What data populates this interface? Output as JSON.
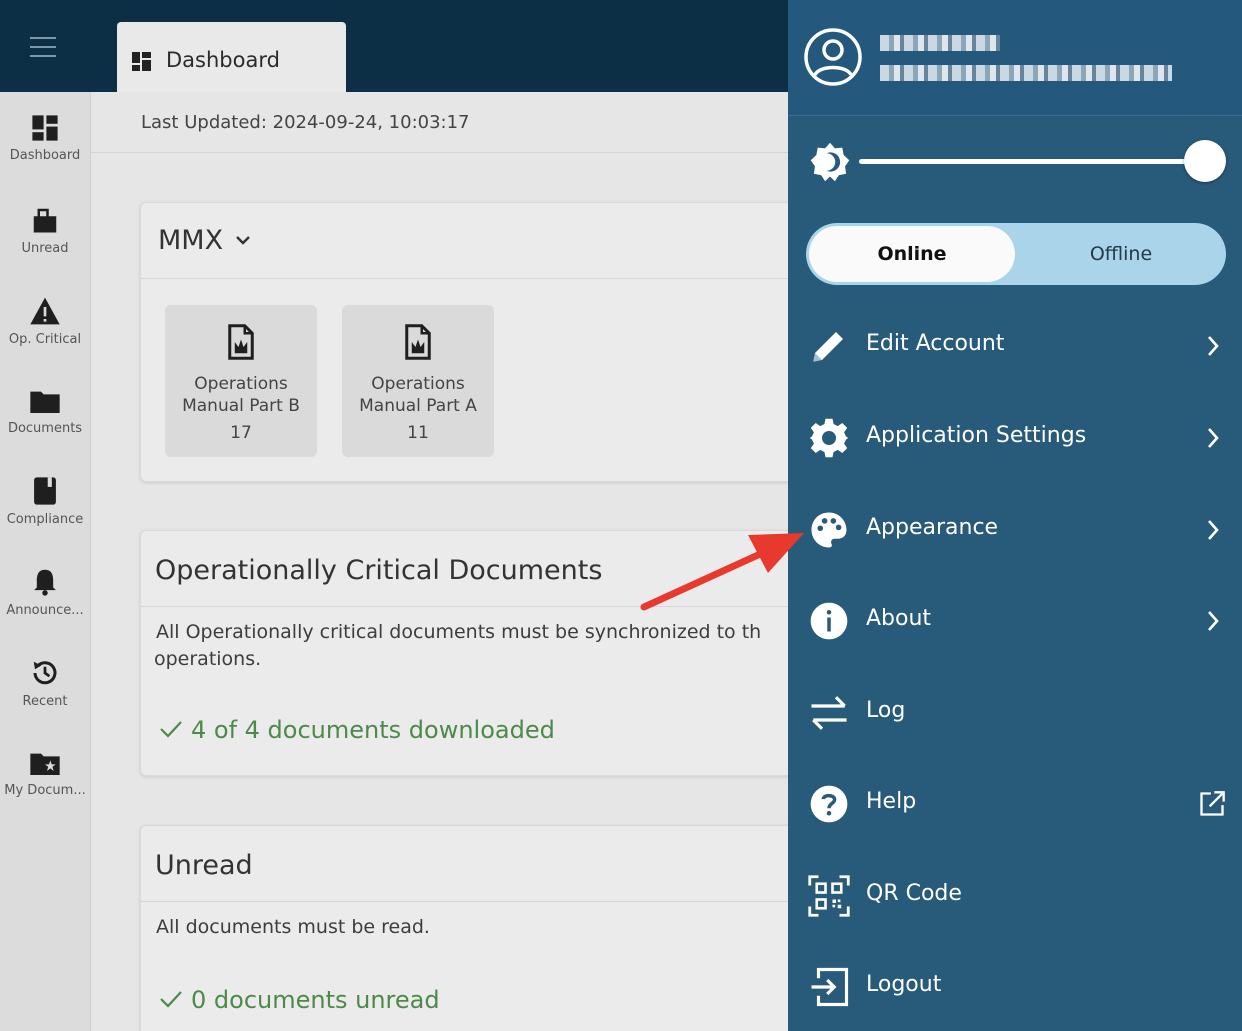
{
  "header": {
    "tab_label": "Dashboard"
  },
  "rail": {
    "items": [
      {
        "label": "Dashboard"
      },
      {
        "label": "Unread"
      },
      {
        "label": "Op. Critical"
      },
      {
        "label": "Documents"
      },
      {
        "label": "Compliance"
      },
      {
        "label": "Announce..."
      },
      {
        "label": "Recent"
      },
      {
        "label": "My Docum..."
      }
    ]
  },
  "main": {
    "last_updated": "Last Updated: 2024-09-24, 10:03:17",
    "mmx": {
      "title": "MMX",
      "documents": [
        {
          "line1": "Operations",
          "line2": "Manual Part B",
          "count": "17"
        },
        {
          "line1": "Operations",
          "line2": "Manual Part A",
          "count": "11"
        }
      ]
    },
    "critical": {
      "title": "Operationally Critical Documents",
      "desc_line1": "All Operationally critical documents must be synchronized to th",
      "desc_line2": "operations.",
      "status": "4 of 4 documents downloaded"
    },
    "unread": {
      "title": "Unread",
      "desc": "All documents must be read.",
      "status": "0 documents unread"
    }
  },
  "drawer": {
    "brightness_value": 1.0,
    "mode_toggle": {
      "online": "Online",
      "offline": "Offline",
      "selected": "Online"
    },
    "menu": [
      {
        "label": "Edit Account",
        "icon": "pencil-icon"
      },
      {
        "label": "Application Settings",
        "icon": "gear-icon"
      },
      {
        "label": "Appearance",
        "icon": "palette-icon"
      },
      {
        "label": "About",
        "icon": "info-icon"
      },
      {
        "label": "Log",
        "icon": "swap-arrows-icon"
      },
      {
        "label": "Help",
        "icon": "help-icon"
      },
      {
        "label": "QR Code",
        "icon": "qr-code-icon"
      },
      {
        "label": "Logout",
        "icon": "logout-icon"
      }
    ]
  },
  "colors": {
    "topbar": "#0d2f45",
    "drawer": "#285a7a",
    "toggle_track": "#a9d4ea",
    "success": "#4d8a4a",
    "annotation": "#e8392e"
  }
}
